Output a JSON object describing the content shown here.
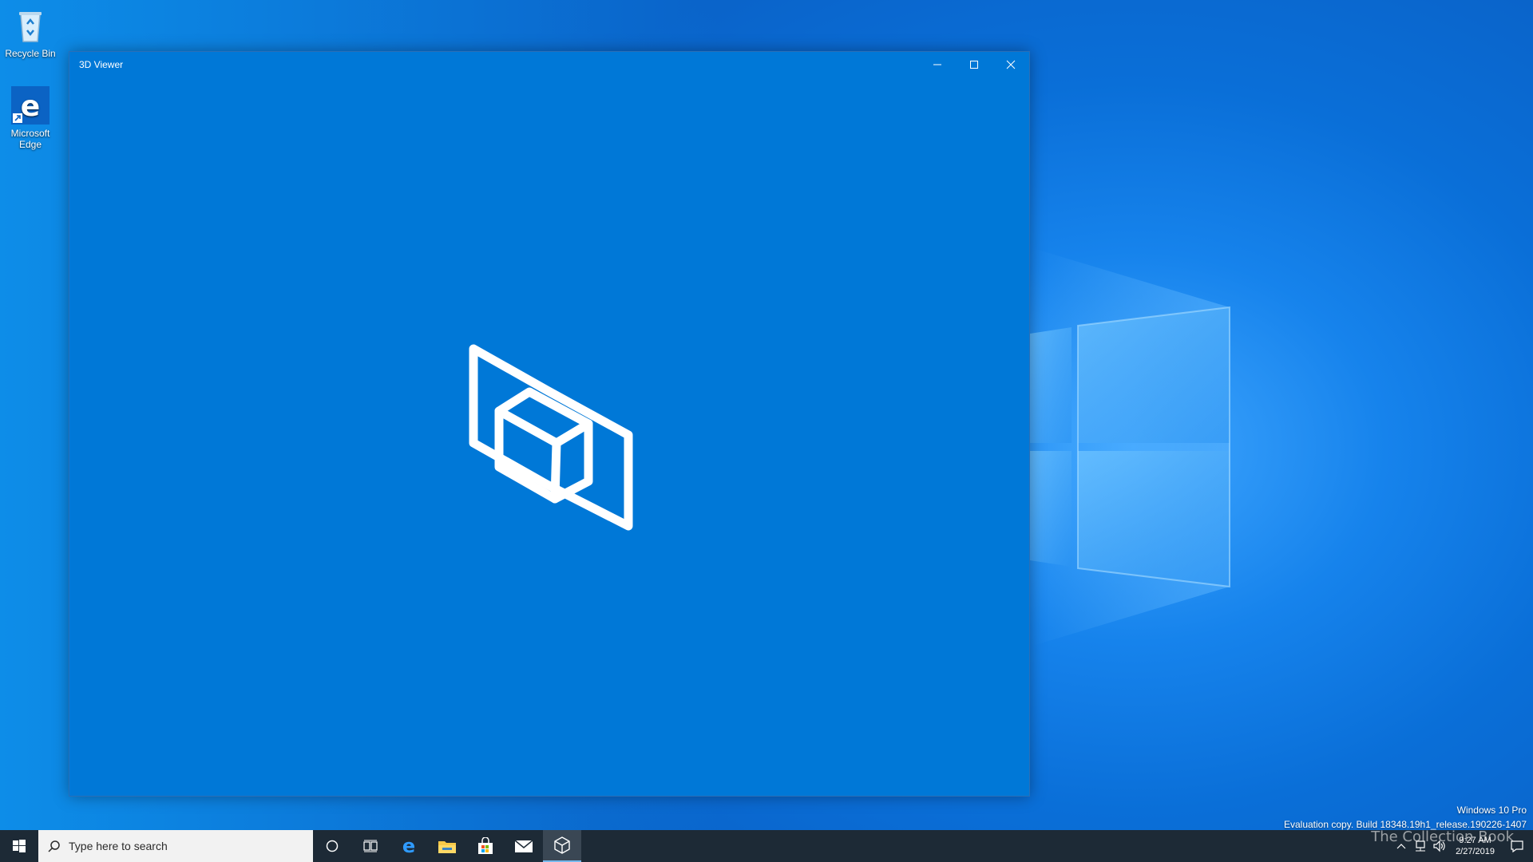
{
  "desktop": {
    "icons": [
      {
        "label": "Recycle Bin"
      },
      {
        "label": "Microsoft Edge"
      }
    ]
  },
  "window": {
    "title": "3D Viewer",
    "accent": "#0078d7"
  },
  "watermark": {
    "edition": "Windows 10 Pro",
    "build": "Evaluation copy. Build 18348.19h1_release.190226-1407"
  },
  "taskbar": {
    "search_placeholder": "Type here to search",
    "pinned": [
      "cortana-icon",
      "task-view-icon",
      "edge-icon",
      "file-explorer-icon",
      "store-icon",
      "mail-icon",
      "3d-viewer-icon"
    ],
    "clock_time": "9:27 AM",
    "clock_date": "2/27/2019",
    "brand_text": "The Collection Book"
  }
}
